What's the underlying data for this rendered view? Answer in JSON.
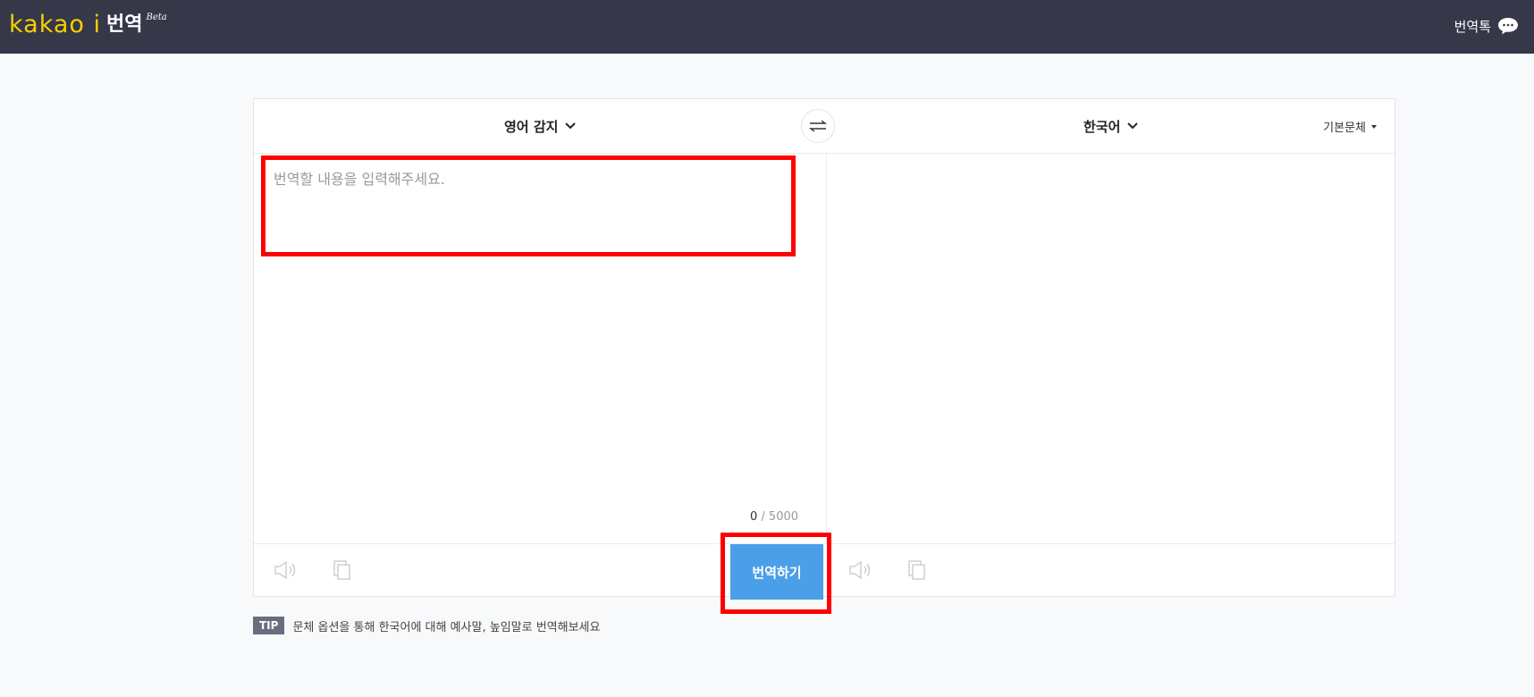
{
  "header": {
    "logo_text": "kakao i",
    "service_name": "번역",
    "beta_label": "Beta",
    "talk_label": "번역톡"
  },
  "translator": {
    "source_lang": "영어 감지",
    "target_lang": "한국어",
    "font_style": "기본문체",
    "input_placeholder": "번역할 내용을 입력해주세요.",
    "char_count": "0",
    "char_limit": "/ 5000",
    "translate_label": "번역하기"
  },
  "tip": {
    "badge": "TIP",
    "text": "문체 옵션을 통해 한국어에 대해 예사말, 높임말로 번역해보세요"
  },
  "colors": {
    "header_bg": "#363748",
    "brand_yellow": "#f7cf00",
    "button_blue": "#4a9fe8",
    "highlight_red": "#ff0000"
  }
}
